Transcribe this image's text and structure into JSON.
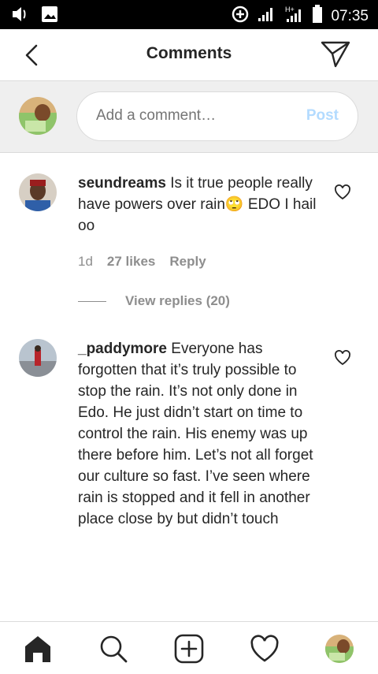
{
  "status_bar": {
    "time": "07:35",
    "icons": [
      "volume-icon",
      "image-icon",
      "data-saver-icon",
      "signal-icon",
      "signal-h-plus-icon",
      "battery-icon"
    ]
  },
  "header": {
    "title": "Comments",
    "back_icon": "chevron-left-icon",
    "share_icon": "paper-plane-icon"
  },
  "compose": {
    "placeholder": "Add a comment…",
    "post_label": "Post"
  },
  "comments": [
    {
      "username": "seundreams",
      "text": "Is it true people really have powers over rain🙄 EDO I hail oo",
      "age": "1d",
      "likes": "27 likes",
      "reply_label": "Reply",
      "view_replies": "View replies (20)"
    },
    {
      "username": "_paddymore",
      "text": "Everyone has forgotten that it’s truly possible to stop the rain. It’s not only done in Edo. He just didn’t start on time to control the rain. His enemy was up there before him. Let’s not all forget our culture so fast. I’ve seen where rain is stopped and it fell in another place close by but didn’t touch"
    }
  ],
  "bottom_nav": [
    "home-icon",
    "search-icon",
    "add-post-icon",
    "activity-heart-icon",
    "profile-avatar"
  ],
  "colors": {
    "text": "#262626",
    "secondary_text": "#8e8e8e",
    "post_disabled": "#b3dbff",
    "status_bar": "#000000",
    "compose_bg": "#efefef"
  }
}
